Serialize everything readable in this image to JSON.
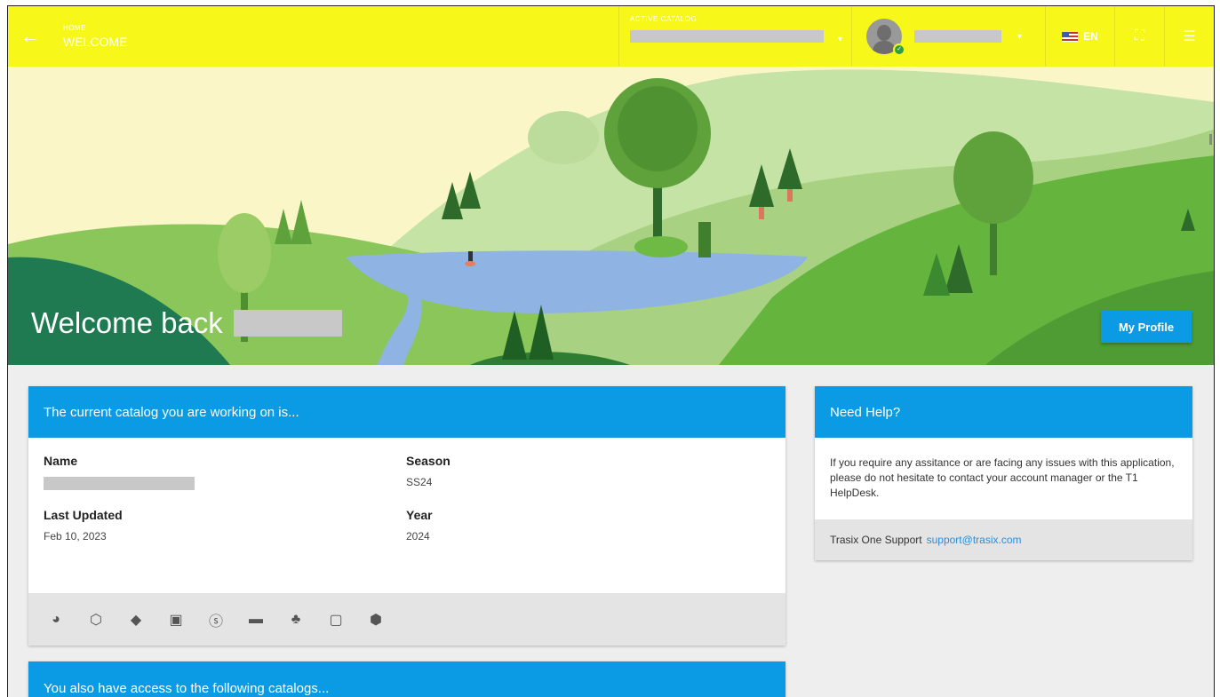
{
  "topbar": {
    "breadcrumb_small": "HOME",
    "breadcrumb_title": "WELCOME",
    "active_catalog_label": "ACTIVE CATALOG",
    "language": "EN"
  },
  "hero": {
    "welcome_text": "Welcome back",
    "profile_button": "My Profile"
  },
  "catalog_card": {
    "header": "The current catalog you are working on is...",
    "name_label": "Name",
    "season_label": "Season",
    "season_value": "SS24",
    "updated_label": "Last Updated",
    "updated_value": "Feb 10, 2023",
    "year_label": "Year",
    "year_value": "2024",
    "icons": [
      "pie-chart-icon",
      "cube-icon",
      "layers-icon",
      "calendar-clock-icon",
      "dollar-icon",
      "folder-icon",
      "hierarchy-icon",
      "image-icon",
      "box-icon"
    ]
  },
  "access_card": {
    "header": "You also have access to the following catalogs..."
  },
  "help_card": {
    "header": "Need Help?",
    "text": "If you require any assitance or are facing any issues with this application, please do not hesitate to contact your account manager or the T1 HelpDesk.",
    "support_label": "Trasix One Support",
    "support_email": "support@trasix.com"
  },
  "colors": {
    "topbar": "#f7f71a",
    "accent": "#0b9be5",
    "online": "#2e9e44"
  }
}
